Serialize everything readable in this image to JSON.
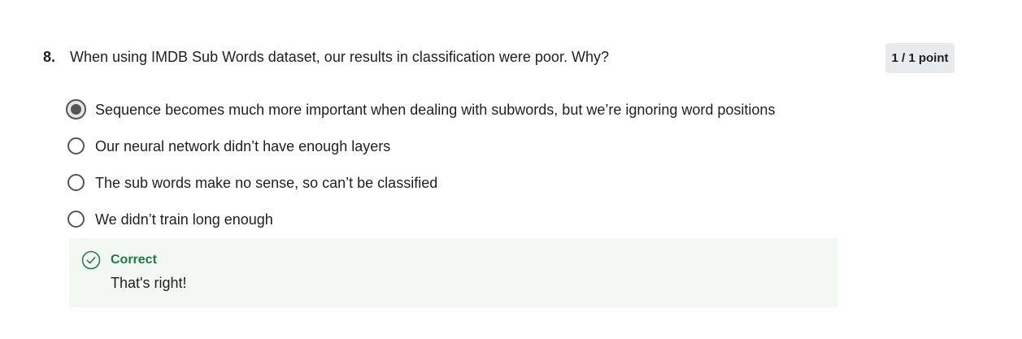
{
  "question": {
    "number": "8.",
    "text": "When using IMDB Sub Words dataset, our results in classification were poor. Why?",
    "points": "1 / 1 point",
    "options": [
      {
        "label": "Sequence becomes much more important when dealing with subwords, but we’re ignoring word positions",
        "selected": true
      },
      {
        "label": "Our neural network didn’t have enough layers",
        "selected": false
      },
      {
        "label": "The sub words make no sense, so can’t be classified",
        "selected": false
      },
      {
        "label": "We didn’t train long enough",
        "selected": false
      }
    ]
  },
  "feedback": {
    "icon": "check-circle-icon",
    "title": "Correct",
    "text": "That's right!",
    "accent_color": "#1e7b3f",
    "background_color": "#f4f8f5"
  }
}
